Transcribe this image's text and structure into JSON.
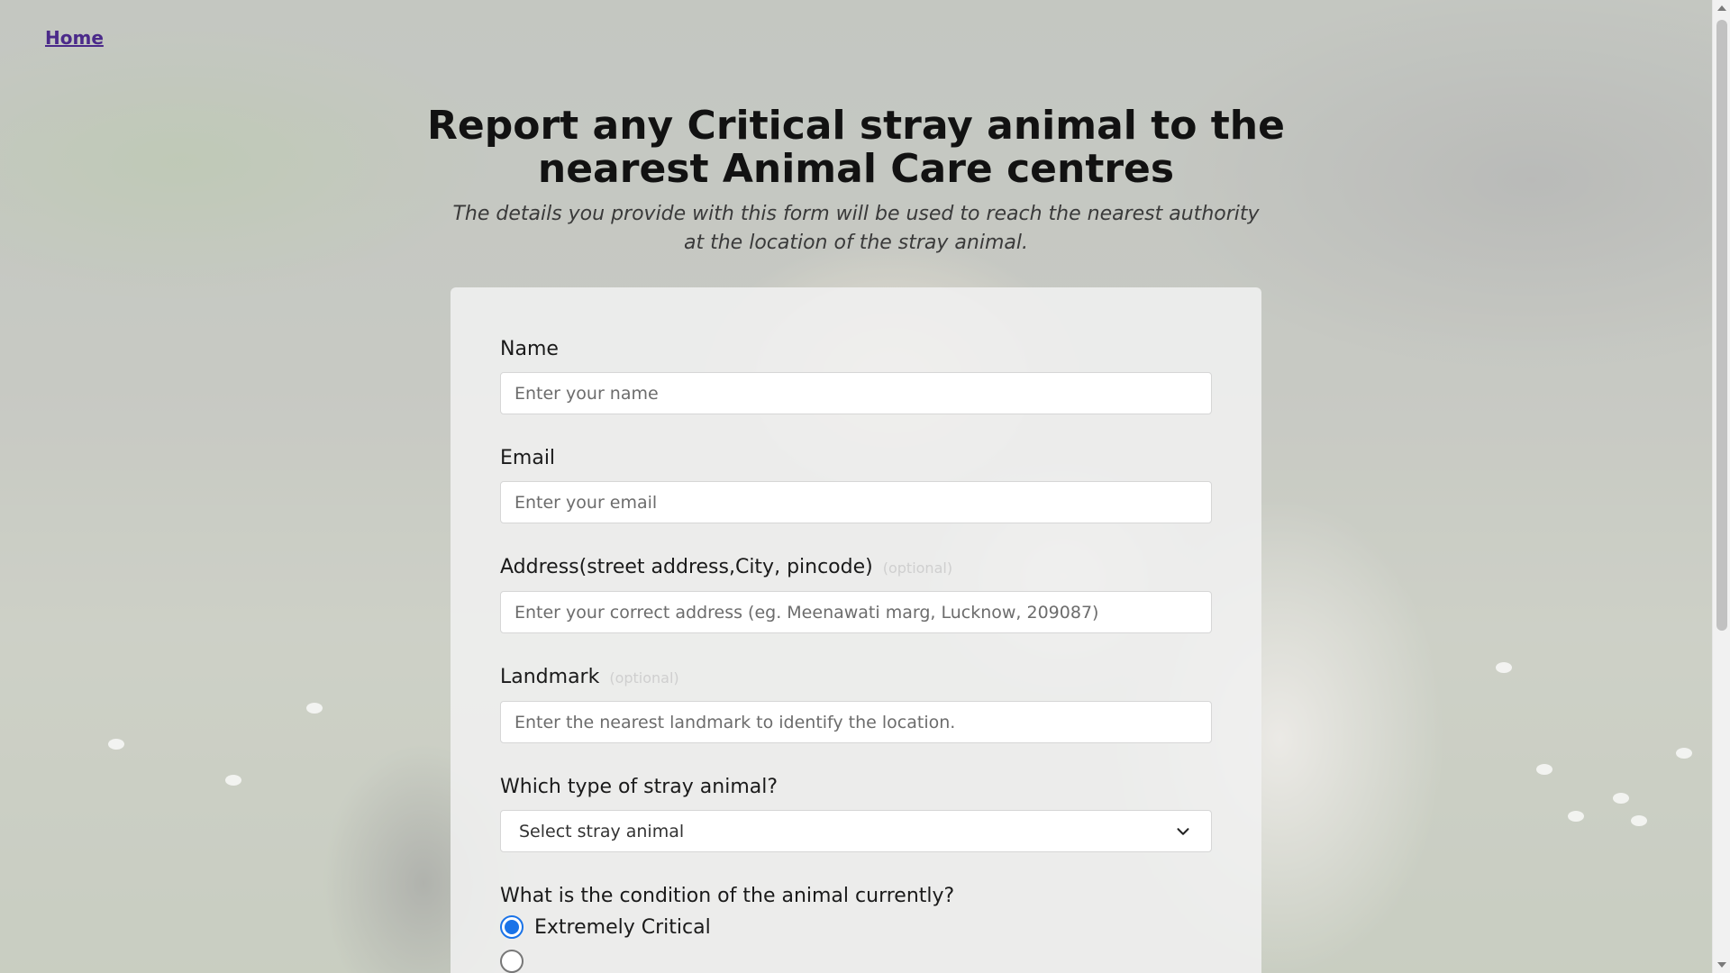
{
  "nav": {
    "home_label": "Home"
  },
  "header": {
    "title": "Report any Critical stray animal to the nearest Animal Care centres",
    "subtitle": "The details you provide with this form will be used to reach the nearest authority at the location of the stray animal."
  },
  "form": {
    "name": {
      "label": "Name",
      "placeholder": "Enter your name"
    },
    "email": {
      "label": "Email",
      "placeholder": "Enter your email"
    },
    "address": {
      "label": "Address(street address,City, pincode)",
      "optional_tag": "(optional)",
      "placeholder": "Enter your correct address (eg. Meenawati marg, Lucknow, 209087)"
    },
    "landmark": {
      "label": "Landmark",
      "optional_tag": "(optional)",
      "placeholder": "Enter the nearest landmark to identify the location."
    },
    "animal_type": {
      "label": "Which type of stray animal?",
      "selected": "Select stray animal"
    },
    "condition": {
      "label": "What is the condition of the animal currently?",
      "options": [
        {
          "label": "Extremely Critical",
          "checked": true
        }
      ]
    }
  },
  "colors": {
    "link": "#4b2a8a",
    "accent": "#1a73e8"
  }
}
